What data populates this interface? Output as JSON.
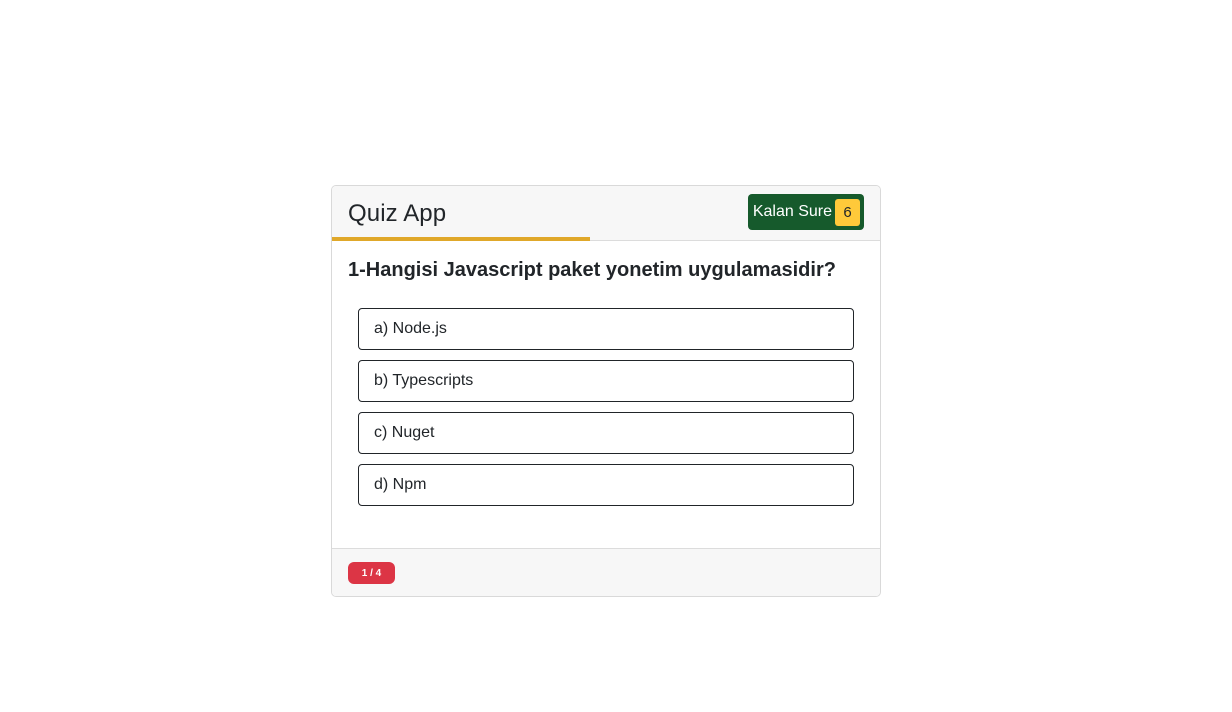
{
  "header": {
    "title": "Quiz App",
    "timer_fraction": 0.47,
    "timer_label": "Kalan Sure",
    "timer_value": "6"
  },
  "question": {
    "text": "1-Hangisi Javascript paket yonetim uygulamasidir?",
    "options": [
      {
        "label": "a) Node.js"
      },
      {
        "label": "b) Typescripts"
      },
      {
        "label": "c) Nuget"
      },
      {
        "label": "d) Npm"
      }
    ]
  },
  "footer": {
    "progress": "1 / 4"
  },
  "colors": {
    "timer_bar": "#e0a82a",
    "timer_bg": "#165a2c",
    "timer_value_bg": "#ffc93a",
    "progress_badge": "#dc3545"
  }
}
